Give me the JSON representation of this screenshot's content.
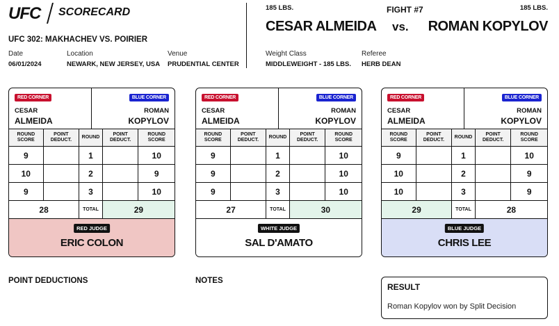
{
  "header": {
    "logo": "UFC",
    "title": "SCORECARD",
    "event": "UFC 302: MAKHACHEV VS. POIRIER",
    "date_label": "Date",
    "date": "06/01/2024",
    "location_label": "Location",
    "location": "NEWARK, NEW JERSEY, USA",
    "venue_label": "Venue",
    "venue": "PRUDENTIAL CENTER"
  },
  "fight": {
    "number": "FIGHT #7",
    "red_weight": "185 LBS.",
    "blue_weight": "185 LBS.",
    "red_fighter": "CESAR ALMEIDA",
    "blue_fighter": "ROMAN KOPYLOV",
    "vs": "vs.",
    "weight_class_label": "Weight Class",
    "weight_class": "MIDDLEWEIGHT - 185 LBS.",
    "referee_label": "Referee",
    "referee": "HERB DEAN"
  },
  "labels": {
    "red_corner": "RED CORNER",
    "blue_corner": "BLUE CORNER",
    "red_first": "CESAR",
    "red_last": "ALMEIDA",
    "blue_first": "ROMAN",
    "blue_last": "KOPYLOV",
    "round_score": "ROUND SCORE",
    "point_deduct": "POINT DEDUCT.",
    "round": "ROUND",
    "total": "TOTAL"
  },
  "cards": [
    {
      "judge_badge": "RED JUDGE",
      "judge_name": "ERIC COLON",
      "judge_color": "#f0c6c4",
      "rounds": [
        {
          "round": "1",
          "red": "9",
          "blue": "10"
        },
        {
          "round": "2",
          "red": "10",
          "blue": "9"
        },
        {
          "round": "3",
          "red": "9",
          "blue": "10"
        }
      ],
      "red_total": "28",
      "blue_total": "29",
      "winner": "blue"
    },
    {
      "judge_badge": "WHITE JUDGE",
      "judge_name": "SAL D'AMATO",
      "judge_color": "#ffffff",
      "rounds": [
        {
          "round": "1",
          "red": "9",
          "blue": "10"
        },
        {
          "round": "2",
          "red": "9",
          "blue": "10"
        },
        {
          "round": "3",
          "red": "9",
          "blue": "10"
        }
      ],
      "red_total": "27",
      "blue_total": "30",
      "winner": "blue"
    },
    {
      "judge_badge": "BLUE JUDGE",
      "judge_name": "CHRIS LEE",
      "judge_color": "#d9def6",
      "rounds": [
        {
          "round": "1",
          "red": "9",
          "blue": "10"
        },
        {
          "round": "2",
          "red": "10",
          "blue": "9"
        },
        {
          "round": "3",
          "red": "10",
          "blue": "9"
        }
      ],
      "red_total": "29",
      "blue_total": "28",
      "winner": "red"
    }
  ],
  "footer": {
    "point_deductions": "POINT DEDUCTIONS",
    "notes": "NOTES",
    "result_title": "RESULT",
    "result_text": "Roman Kopylov won by Split Decision"
  }
}
